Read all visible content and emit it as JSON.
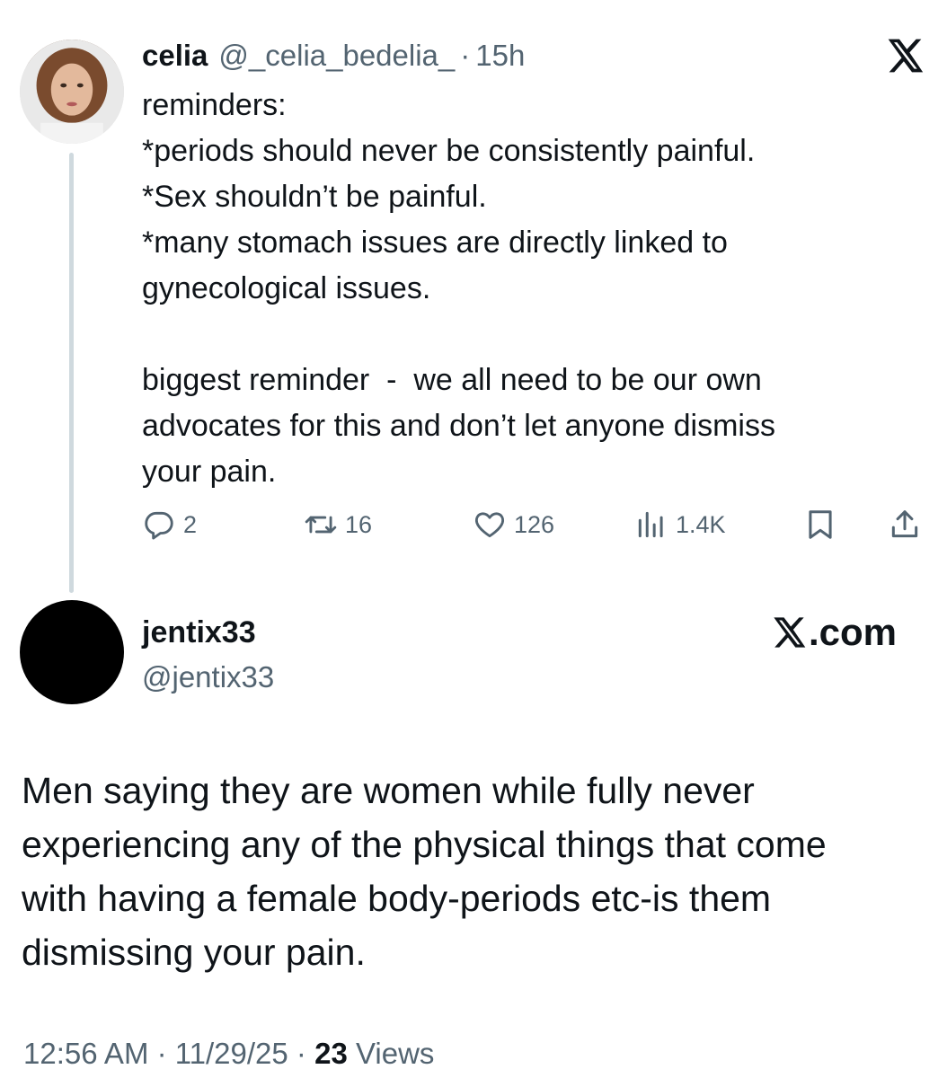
{
  "quoted_tweet": {
    "avatar_icon": "user-photo-avatar",
    "display_name": "celia",
    "handle": "@_celia_bedelia_",
    "separator": "·",
    "time": "15h",
    "platform_icon": "x-logo-icon",
    "text_lines": [
      "reminders:",
      "*periods should never be consistently painful.",
      "*Sex shouldn’t be painful.",
      "*many stomach issues are directly linked to",
      "gynecological issues.",
      "",
      "biggest reminder  -  we all need to be our own",
      "advocates for this and don’t let anyone dismiss",
      "your pain."
    ],
    "actions": {
      "reply": {
        "icon": "reply-icon",
        "count": "2"
      },
      "retweet": {
        "icon": "retweet-icon",
        "count": "16"
      },
      "like": {
        "icon": "heart-icon",
        "count": "126"
      },
      "views": {
        "icon": "views-icon",
        "count": "1.4K"
      },
      "bookmark": {
        "icon": "bookmark-icon"
      },
      "share": {
        "icon": "share-icon"
      }
    }
  },
  "main_tweet": {
    "avatar_icon": "black-circle-avatar",
    "display_name": "jentix33",
    "handle": "@jentix33",
    "brand": {
      "icon": "x-logo-icon",
      "text": ".com"
    },
    "text_lines": [
      "Men saying they are women while fully never",
      "experiencing any of the physical things that come",
      "with having a female body-periods etc-is them",
      "dismissing your pain."
    ],
    "timestamp": "12:56 AM · 11/29/25 · ",
    "views_count": "23",
    "views_label": " Views"
  },
  "colors": {
    "text_primary": "#0f1419",
    "text_secondary": "#536471",
    "thread_line": "#cfd9de",
    "background": "#ffffff"
  }
}
